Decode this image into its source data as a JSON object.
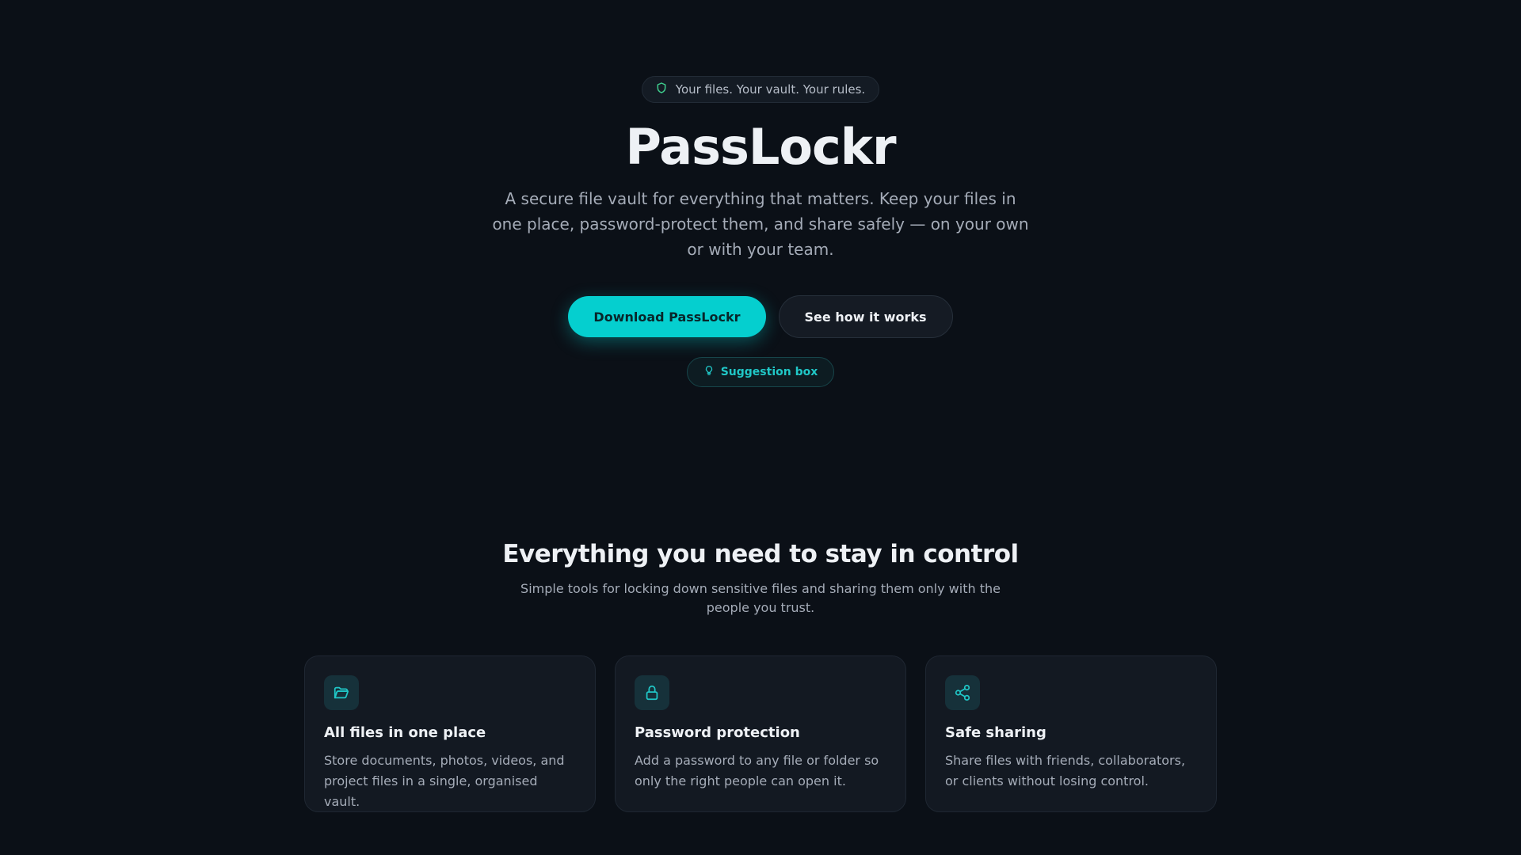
{
  "hero": {
    "tagline": "Your files. Your vault. Your rules.",
    "tagline_icon": "shield-icon",
    "title": "PassLockr",
    "subtitle": "A secure file vault for everything that matters. Keep your files in one place, password-protect them, and share safely — on your own or with your team.",
    "primary_cta": "Download PassLockr",
    "secondary_cta": "See how it works",
    "suggestion_label": "Suggestion box",
    "suggestion_icon": "lightbulb-icon"
  },
  "features": {
    "heading": "Everything you need to stay in control",
    "lead": "Simple tools for locking down sensitive files and sharing them only with the people you trust.",
    "items": [
      {
        "icon": "folder-open-icon",
        "title": "All files in one place",
        "description": "Store documents, photos, videos, and project files in a single, organised vault."
      },
      {
        "icon": "lock-icon",
        "title": "Password protection",
        "description": "Add a password to any file or folder so only the right people can open it."
      },
      {
        "icon": "share-icon",
        "title": "Safe sharing",
        "description": "Share files with friends, collaborators, or clients without losing control."
      }
    ]
  },
  "colors": {
    "background": "#0b1017",
    "accent": "#05cfcf",
    "tagline_icon": "#3fcf8e"
  }
}
